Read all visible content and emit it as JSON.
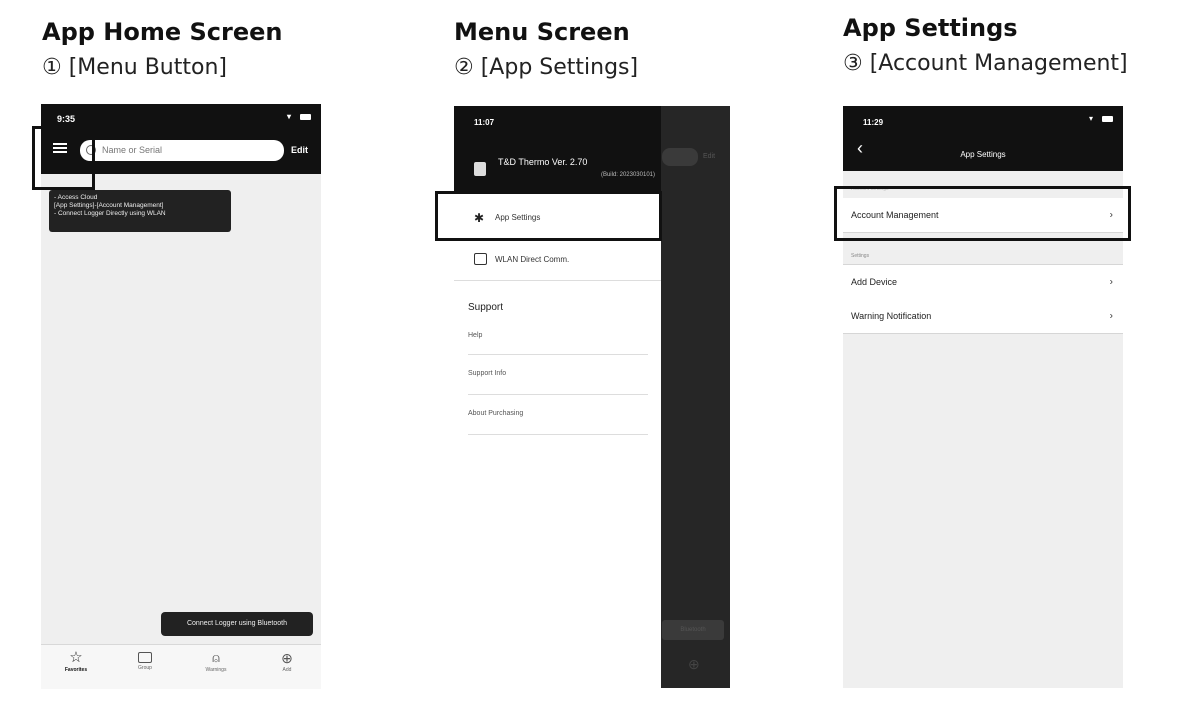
{
  "columns": [
    {
      "title": "App Home Screen",
      "subtitle": "① [Menu Button]"
    },
    {
      "title": "Menu Screen",
      "subtitle": "② [App Settings]"
    },
    {
      "title": "App Settings",
      "subtitle": "③ [Account Management]"
    }
  ],
  "home": {
    "time": "9:35",
    "search_placeholder": "Name or Serial",
    "edit_label": "Edit",
    "tooltip_line1": "- Access Cloud",
    "tooltip_line2": "[App Settings]-[Account Management]",
    "tooltip_line3": "- Connect Logger Directly using WLAN",
    "bt_tooltip": "Connect Logger using Bluetooth",
    "tabs": [
      {
        "label": "Favorites",
        "icon": "star-icon"
      },
      {
        "label": "Group",
        "icon": "group-icon"
      },
      {
        "label": "Warnings",
        "icon": "bell-icon"
      },
      {
        "label": "Add",
        "icon": "plus-circle-icon"
      }
    ]
  },
  "menu": {
    "time": "11:07",
    "app_name": "T&D Thermo Ver. 2.70",
    "build": "(Build: 2023030101)",
    "app_settings_label": "App Settings",
    "wlan_label": "WLAN Direct Comm.",
    "support_header": "Support",
    "help_label": "Help",
    "support_info_label": "Support Info",
    "about_purchasing_label": "About Purchasing",
    "bg_edit_label": "Edit",
    "bg_bt_label": "Bluetooth"
  },
  "settings": {
    "time": "11:29",
    "nav_title": "App Settings",
    "account_section_header": "Account Settings",
    "account_management_label": "Account Management",
    "settings_section_header": "Settings",
    "add_device_label": "Add Device",
    "warning_notification_label": "Warning Notification"
  }
}
